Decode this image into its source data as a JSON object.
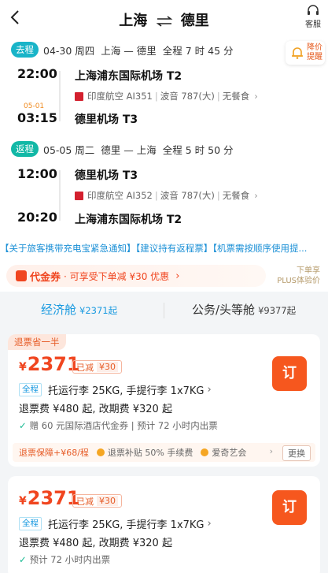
{
  "header": {
    "from_city": "上海",
    "to_city": "德里",
    "service_label": "客服"
  },
  "price_alert": {
    "label": "降价提醒"
  },
  "outbound": {
    "tag": "去程",
    "date": "04-30 周四",
    "route": "上海 — 德里",
    "duration": "全程 7 时 45 分",
    "dep_time": "22:00",
    "dep_airport": "上海浦东国际机场 T2",
    "airline": "印度航空 AI351",
    "aircraft": "波音 787(大)",
    "meal": "无餐食",
    "arr_date_note": "05-01",
    "arr_time": "03:15",
    "arr_airport": "德里机场 T3"
  },
  "return": {
    "tag": "返程",
    "date": "05-05 周二",
    "route": "德里 — 上海",
    "duration": "全程 5 时 50 分",
    "dep_time": "12:00",
    "dep_airport": "德里机场 T3",
    "airline": "印度航空 AI352",
    "aircraft": "波音 787(大)",
    "meal": "无餐食",
    "arr_time": "20:20",
    "arr_airport": "上海浦东国际机场 T2"
  },
  "notice": "【关于旅客携带充电宝紧急通知】【建议持有返程票】【机票需按顺序使用提...",
  "voucher": {
    "name": "代金券",
    "desc": "· 可享受下单减 ¥30 优惠",
    "plus_line1": "下单享",
    "plus_line2": "PLUS体验价"
  },
  "tabs": [
    {
      "label": "经济舱",
      "price": "¥2371起"
    },
    {
      "label": "公务/头等舱",
      "price": "¥9377起"
    }
  ],
  "offers": [
    {
      "badge": "退票省一半",
      "currency": "¥",
      "price": "2371",
      "cut_label": "已减",
      "cut_value": "¥30",
      "book_label": "订",
      "cabin_tag": "全程",
      "luggage": "托运行李 25KG, 手提行李 1x7KG",
      "refund": "退票费 ¥480 起, 改期费 ¥320 起",
      "perk": "赠 60 元国际酒店代金券 | 预计 72 小时内出票",
      "strip_main": "退票保障",
      "strip_price": "+¥68/程",
      "strip_item1": "退票补贴 50% 手续费",
      "strip_item2": "爱奇艺会",
      "strip_change": "更换"
    },
    {
      "currency": "¥",
      "price": "2371",
      "cut_label": "已减",
      "cut_value": "¥30",
      "book_label": "订",
      "cabin_tag": "全程",
      "luggage": "托运行李 25KG, 手提行李 1x7KG",
      "refund": "退票费 ¥480 起, 改期费 ¥320 起",
      "perk": "预计 72 小时内出票"
    }
  ]
}
